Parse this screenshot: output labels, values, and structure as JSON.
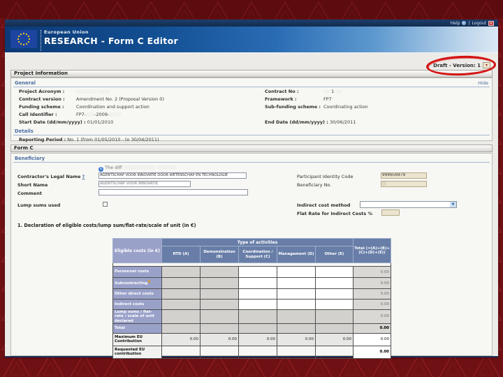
{
  "topbar": {
    "help": "Help",
    "logout": "Logout"
  },
  "header": {
    "org": "European Union",
    "title": "RESEARCH - Form C Editor"
  },
  "version": {
    "label": "Draft - Version: 1"
  },
  "icons": {
    "logout_x": "✕",
    "dropdown_arrow": "▾",
    "select_arrow": "▼",
    "info": "i",
    "help": "?",
    "warning": "✱"
  },
  "colors": {
    "slide_red": "#6e1014",
    "header_blue": "#124e92",
    "table_periwinkle": "#9aa1c9",
    "table_steel_blue": "#687ea8",
    "annotation_red": "#d41414",
    "beige_field": "#ece4cf"
  },
  "project_info": {
    "title": "Project Information",
    "general": "General",
    "hide": "Hide",
    "details": "Details",
    "acronym_label": "Project Acronym :",
    "contract_version_label": "Contract version :",
    "contract_version_value": "Amendment No. 2 (Proposal Version 0)",
    "funding_label": "Funding scheme :",
    "funding_value": "Coordination and support action",
    "call_label": "Call Identifier :",
    "call_prefix": "FP7-",
    "call_mid": "-2009-",
    "start_label": "Start Date (dd/mm/yyyy) :",
    "start_value": "01/01/2010",
    "contract_no_label": "Contract No :",
    "contract_no_fragment": "1",
    "framework_label": "Framework :",
    "framework_value": "FP7",
    "subfunding_label": "Sub-funding scheme :",
    "subfunding_value": "Coordinating action",
    "end_label": "End Date (dd/mm/yyyy) :",
    "end_value": "30/06/2011",
    "reporting_label": "Reporting Period :",
    "reporting_value": "No. 1 (from 01/05/2010 - to 30/04/2011)"
  },
  "form_c": {
    "title": "Form C",
    "beneficiary": "Beneficiary",
    "info_fragment": "The diff",
    "legal_name_label": "Contractor's Legal Name",
    "legal_name_value": "AGENTSCHAP VOOR INNOVATIE DOOR WETENSCHAP EN TECHNOLOGIE",
    "short_name_label": "Short Name",
    "short_name_value": "AGENTSCHAP VOOR INNOVATIE",
    "comment_label": "Comment",
    "pic_label": "Participant Identity Code",
    "pic_value": "999656979",
    "beneficiary_no_label": "Beneficiary No.",
    "lump_sums_label": "Lump sums used",
    "indirect_method_label": "Indirect cost method",
    "flat_rate_label": "Flat Rate for Indirect Costs %",
    "declaration_title": "1. Declaration of eligible costs/lump sum/flat-rate/scale of unit (in €)"
  },
  "cost_table": {
    "eligible_header": "Eligible costs (in €)",
    "activities_header": "Type of activities",
    "col_rtd": "RTD (A)",
    "col_demo": "Demonstration (B)",
    "col_coord": "Coordination / Support (C)",
    "col_mgmt": "Management (D)",
    "col_other": "Other (E)",
    "col_total": "Total (=(A)+(B)+(C)+(D)+(E))",
    "row_personnel": {
      "label": "Personnel costs",
      "total": "0.00"
    },
    "row_subcontracting": {
      "label": "Subcontracting",
      "total": "0.00"
    },
    "row_other_direct": {
      "label": "Other direct costs",
      "total": "0.00"
    },
    "row_indirect": {
      "label": "Indirect costs",
      "total": "0.00"
    },
    "row_lump": {
      "label": "Lump sums / flat-rate / scale of unit declared",
      "total": "0.00"
    },
    "row_total": {
      "label": "Total",
      "total": "0.00"
    },
    "row_max_eu": {
      "label": "Maximum EU Contribution",
      "values": [
        "0.00",
        "0.00",
        "0.00",
        "0.00",
        "0.00"
      ],
      "total": "0.00"
    },
    "row_requested": {
      "label": "Requested EU contribution",
      "total": "0.00"
    }
  }
}
